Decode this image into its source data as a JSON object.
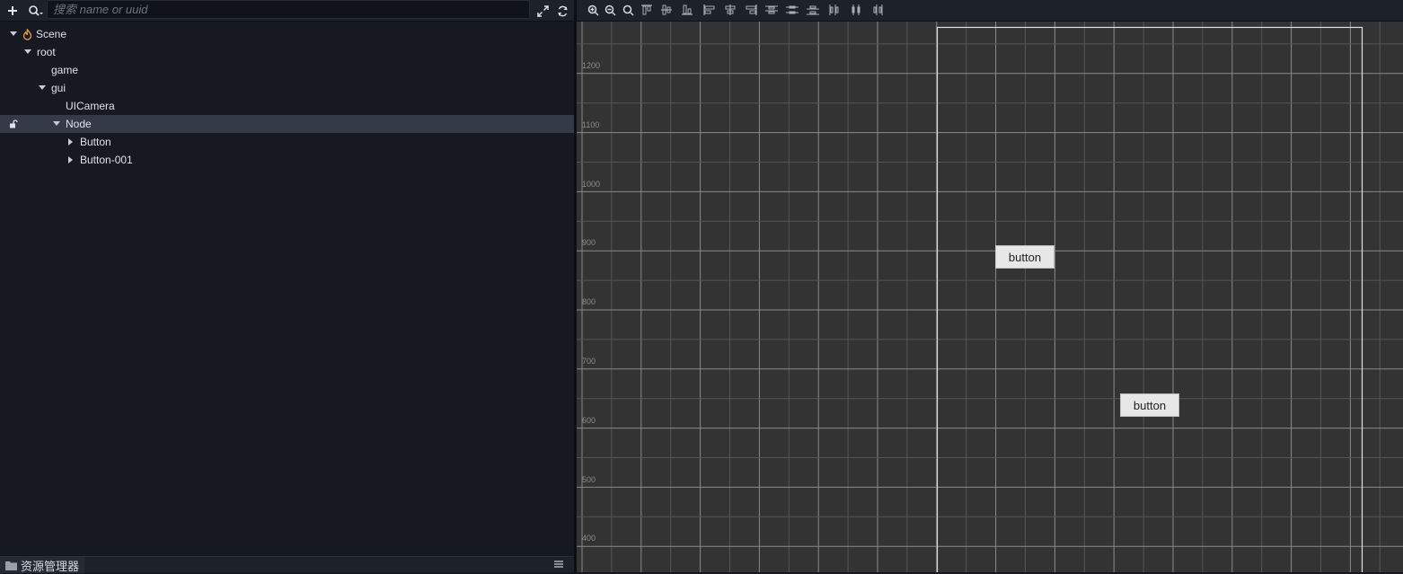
{
  "hierarchy": {
    "search_placeholder": "搜索 name or uuid",
    "tree": [
      {
        "label": "Scene",
        "depth": 0,
        "arrow": "down",
        "icon": "flame-icon"
      },
      {
        "label": "root",
        "depth": 1,
        "arrow": "down"
      },
      {
        "label": "game",
        "depth": 2,
        "arrow": "none"
      },
      {
        "label": "gui",
        "depth": 2,
        "arrow": "down"
      },
      {
        "label": "UICamera",
        "depth": 3,
        "arrow": "none"
      },
      {
        "label": "Node",
        "depth": 3,
        "arrow": "down",
        "selected": true,
        "locked": true
      },
      {
        "label": "Button",
        "depth": 4,
        "arrow": "right"
      },
      {
        "label": "Button-001",
        "depth": 4,
        "arrow": "right"
      }
    ]
  },
  "bottom_panel": {
    "tab_label": "资源管理器"
  },
  "scene": {
    "ruler_labels": [
      "1200",
      "1100",
      "1000",
      "900",
      "800",
      "700",
      "600",
      "500",
      "400"
    ],
    "buttons": [
      "button",
      "button"
    ]
  },
  "colors": {
    "panel_bg": "#161922",
    "selected_row": "#353a47",
    "scene_bg": "#333333",
    "accent_flame": "#e8a33d"
  }
}
